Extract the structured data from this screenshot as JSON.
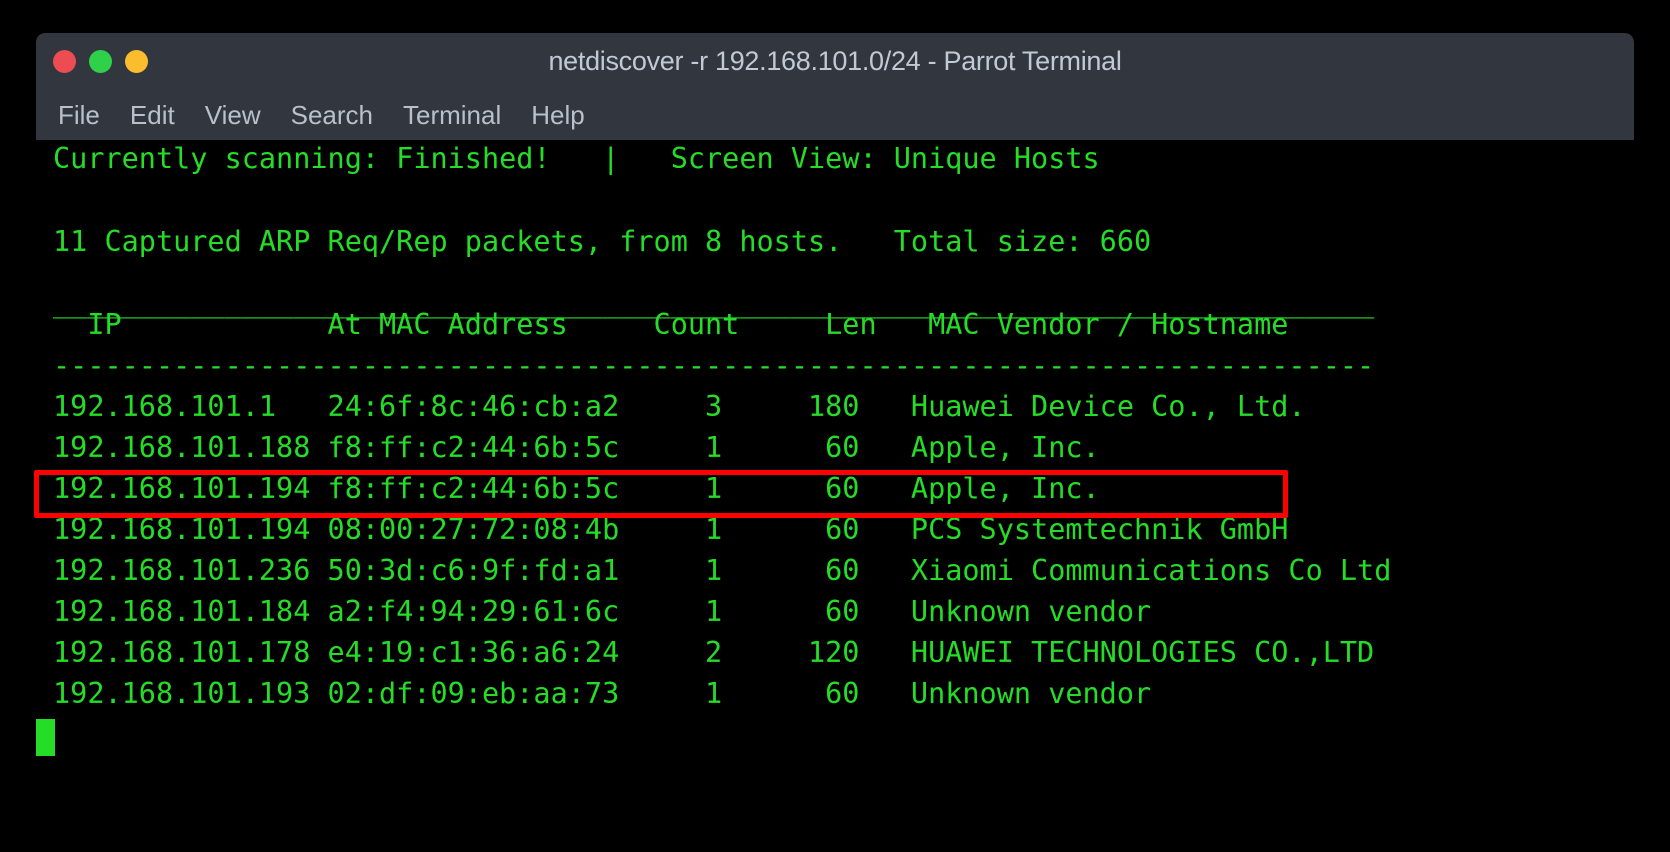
{
  "window": {
    "title": "netdiscover -r 192.168.101.0/24 - Parrot Terminal",
    "controls": {
      "close_label": "",
      "minimize_label": "",
      "maximize_label": ""
    },
    "colors": {
      "titlebar_bg": "#31363f",
      "terminal_bg": "#000000",
      "terminal_fg": "#25dd27",
      "close_dot": "#ed4c52",
      "minimize_dot": "#2fd14b",
      "maximize_dot": "#fbbd2e",
      "highlight_box": "#fe0000"
    }
  },
  "menu": {
    "items": [
      {
        "label": "File"
      },
      {
        "label": "Edit"
      },
      {
        "label": "View"
      },
      {
        "label": "Search"
      },
      {
        "label": "Terminal"
      },
      {
        "label": "Help"
      }
    ]
  },
  "terminal": {
    "status_line": "Currently scanning: Finished!   |   Screen View: Unique Hosts",
    "summary_line": "11 Captured ARP Req/Rep packets, from 8 hosts.   Total size: 660",
    "rule_top": "_____________________________________________________________________________",
    "rule_mid": "-----------------------------------------------------------------------------",
    "header_line": "  IP            At MAC Address     Count     Len   MAC Vendor / Hostname",
    "headers": [
      "IP",
      "At MAC Address",
      "Count",
      "Len",
      "MAC Vendor / Hostname"
    ],
    "rows": [
      {
        "line": "192.168.101.1   24:6f:8c:46:cb:a2     3     180   Huawei Device Co., Ltd.",
        "ip": "192.168.101.1",
        "mac": "24:6f:8c:46:cb:a2",
        "count": "3",
        "len": "180",
        "vendor": "Huawei Device Co., Ltd.",
        "highlighted": false
      },
      {
        "line": "192.168.101.188 f8:ff:c2:44:6b:5c     1      60   Apple, Inc.",
        "ip": "192.168.101.188",
        "mac": "f8:ff:c2:44:6b:5c",
        "count": "1",
        "len": "60",
        "vendor": "Apple, Inc.",
        "highlighted": false
      },
      {
        "line": "192.168.101.194 f8:ff:c2:44:6b:5c     1      60   Apple, Inc.",
        "ip": "192.168.101.194",
        "mac": "f8:ff:c2:44:6b:5c",
        "count": "1",
        "len": "60",
        "vendor": "Apple, Inc.",
        "highlighted": true
      },
      {
        "line": "192.168.101.194 08:00:27:72:08:4b     1      60   PCS Systemtechnik GmbH",
        "ip": "192.168.101.194",
        "mac": "08:00:27:72:08:4b",
        "count": "1",
        "len": "60",
        "vendor": "PCS Systemtechnik GmbH",
        "highlighted": false
      },
      {
        "line": "192.168.101.236 50:3d:c6:9f:fd:a1     1      60   Xiaomi Communications Co Ltd",
        "ip": "192.168.101.236",
        "mac": "50:3d:c6:9f:fd:a1",
        "count": "1",
        "len": "60",
        "vendor": "Xiaomi Communications Co Ltd",
        "highlighted": false
      },
      {
        "line": "192.168.101.184 a2:f4:94:29:61:6c     1      60   Unknown vendor",
        "ip": "192.168.101.184",
        "mac": "a2:f4:94:29:61:6c",
        "count": "1",
        "len": "60",
        "vendor": "Unknown vendor",
        "highlighted": false
      },
      {
        "line": "192.168.101.178 e4:19:c1:36:a6:24     2     120   HUAWEI TECHNOLOGIES CO.,LTD",
        "ip": "192.168.101.178",
        "mac": "e4:19:c1:36:a6:24",
        "count": "2",
        "len": "120",
        "vendor": "HUAWEI TECHNOLOGIES CO.,LTD",
        "highlighted": false
      },
      {
        "line": "192.168.101.193 02:df:09:eb:aa:73     1      60   Unknown vendor",
        "ip": "192.168.101.193",
        "mac": "02:df:09:eb:aa:73",
        "count": "1",
        "len": "60",
        "vendor": "Unknown vendor",
        "highlighted": false
      }
    ],
    "cursor": "block"
  }
}
